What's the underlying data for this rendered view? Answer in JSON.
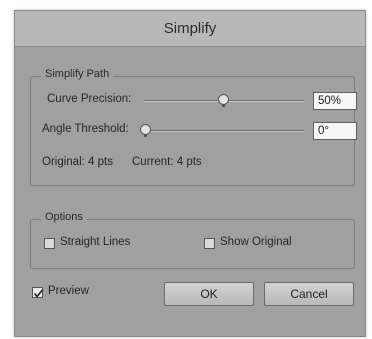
{
  "dialog": {
    "title": "Simplify"
  },
  "simplify_path": {
    "legend": "Simplify Path",
    "curve_precision": {
      "label": "Curve Precision:",
      "value": "50%",
      "slider_fraction": 0.5
    },
    "angle_threshold": {
      "label": "Angle Threshold:",
      "value": "0°",
      "slider_fraction": 0.0
    },
    "original": "Original: 4 pts",
    "current": "Current: 4 pts"
  },
  "options": {
    "legend": "Options",
    "straight_lines": {
      "label": "Straight Lines",
      "checked": false
    },
    "show_original": {
      "label": "Show Original",
      "checked": false
    }
  },
  "footer": {
    "preview": {
      "label": "Preview",
      "checked": true
    },
    "ok_label": "OK",
    "cancel_label": "Cancel"
  },
  "colors": {
    "dialog_bg": "#a0a0a0",
    "titlebar_bg": "#b8b8b8"
  }
}
